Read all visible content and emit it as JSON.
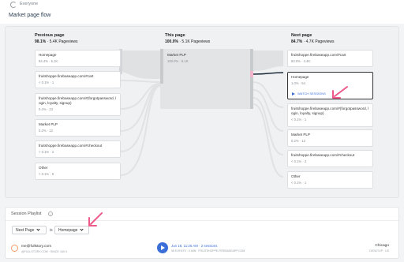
{
  "header": {
    "segment_label": "Everyone",
    "page_title": "Market page flow"
  },
  "columns": {
    "previous": {
      "title": "Previous page",
      "pct": "98.1%",
      "views": "5.4K Pageviews"
    },
    "this": {
      "title": "This page",
      "pct": "100.0%",
      "views": "5.1K Pageviews"
    },
    "next": {
      "title": "Next page",
      "pct": "84.7%",
      "views": "4.7K Pageviews"
    }
  },
  "previous_nodes": [
    {
      "label": "Homepage",
      "value": "94.4% · 5.1K"
    },
    {
      "label": "fruitshoppe.firebaseapp.com/#cart",
      "value": "< 0.1% · 1"
    },
    {
      "label": "fruitshoppe.firebaseapp.com/#(forgotpassword, login, loyalty, signup)",
      "value": "0.4% · 23"
    },
    {
      "label": "Market PLP",
      "value": "0.2% · 12"
    },
    {
      "label": "fruitshoppe.firebaseapp.com/#checkout",
      "value": "< 0.1% · 2"
    },
    {
      "label": "Other",
      "value": "< 0.1% · 6"
    }
  ],
  "this_node": {
    "label": "Market PLP",
    "value": "100.0% · 5.1K"
  },
  "next_nodes": [
    {
      "label": "fruitshoppe.firebaseapp.com/#cart",
      "value": "83.0% · 4.4K"
    },
    {
      "label": "Homepage",
      "value": "1.0% · 54",
      "action": "WATCH SESSIONS"
    },
    {
      "label": "fruitshoppe.firebaseapp.com/#(forgotpassword, login, loyalty, signup)",
      "value": "< 0.1% · 1"
    },
    {
      "label": "Market PLP",
      "value": "0.2% · 12"
    },
    {
      "label": "fruitshoppe.firebaseapp.com/#checkout",
      "value": "< 0.1% · 2"
    },
    {
      "label": "Other",
      "value": "< 0.1% · 1"
    }
  ],
  "playlist": {
    "title": "Session Playlist",
    "info_icon": "i",
    "filter_page": "Next Page",
    "operator": "is",
    "filter_value": "Homepage",
    "session": {
      "email": "me@fullstory.com",
      "user_sub": "@FULLSTORY.COM · SINCE JUN 1",
      "title": "Jun 18, 11:26 AM · 2 sessions",
      "sub": "58 EVENTS · 0 MIN · FRUITSHOPPE.FIREBASEAPP.COM",
      "city": "Chicago",
      "device": "DESKTOP · US"
    }
  },
  "colors": {
    "accent": "#3b6fd8",
    "annotation": "#ee5a8a",
    "flow": "#e4e6e8",
    "avatar": "#f29b6b"
  },
  "icons": {
    "segment": "spinner-icon",
    "play": "play-icon",
    "info": "info-icon",
    "chevron": "chevron-down-icon",
    "annotation_arrow": "pink-arrow-icon"
  }
}
